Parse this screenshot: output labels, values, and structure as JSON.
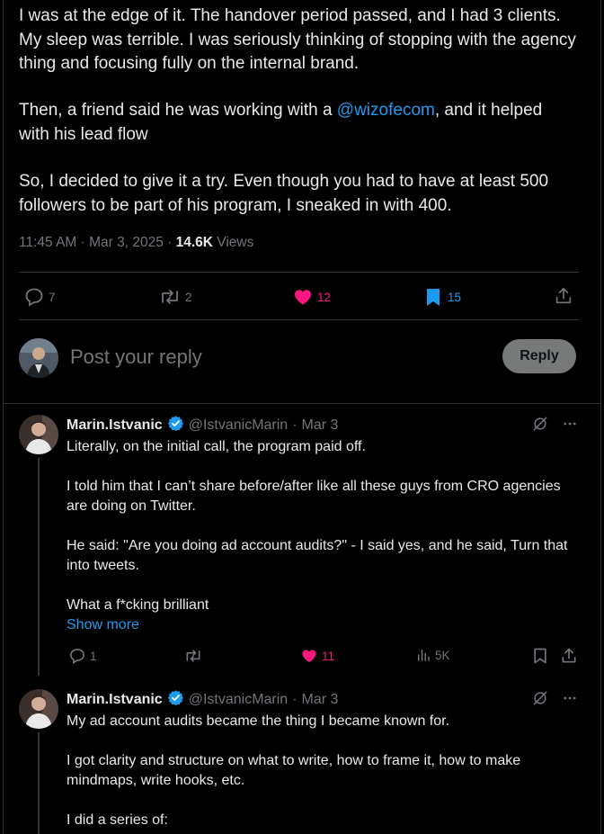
{
  "main_tweet": {
    "paragraphs": [
      "I was at the edge of it. The handover period passed, and I had 3 clients. My sleep was terrible. I was seriously thinking of stopping with the agency thing and focusing fully on the internal brand.",
      "with his lead flow",
      "So, I decided to give it a try. Even though you had to have at least 500 followers to be part of his program, I sneaked in with 400."
    ],
    "p2_prefix": "Then, a friend said he was working with a ",
    "p2_mention": "@wizofecom",
    "p2_suffix": ", and it helped",
    "timestamp": "11:45 AM · Mar 3, 2025 · ",
    "views_count": "14.6K",
    "views_label": " Views",
    "replies": "7",
    "reposts": "2",
    "likes": "12",
    "bookmarks": "15"
  },
  "reply_box": {
    "placeholder": "Post your reply",
    "button_label": "Reply"
  },
  "replies": [
    {
      "name": "Marin.Istvanic",
      "handle": "@IstvanicMarin",
      "dot": "·",
      "date": "Mar 3",
      "lines": [
        "Literally, on the initial call, the program paid off.",
        "I told him that I can’t share before/after like all these guys from CRO agencies are doing on Twitter.",
        "He said: \"Are you doing ad account audits?\" - I said yes, and he said, Turn that into tweets.",
        "What a f*cking brilliant"
      ],
      "show_more": "Show more",
      "reply_count": "1",
      "repost_count": "",
      "like_count": "11",
      "views": "5K"
    },
    {
      "name": "Marin.Istvanic",
      "handle": "@IstvanicMarin",
      "dot": "·",
      "date": "Mar 3",
      "lines": [
        "My ad account audits became the thing I became known for.",
        "I got clarity and structure on what to write, how to frame it, how to make mindmaps, write hooks, etc.",
        "I did a series of:"
      ]
    }
  ],
  "colors": {
    "accent": "#1d9bf0",
    "like": "#f91880",
    "bookmark": "#1d9bf0",
    "muted": "#71767b"
  }
}
